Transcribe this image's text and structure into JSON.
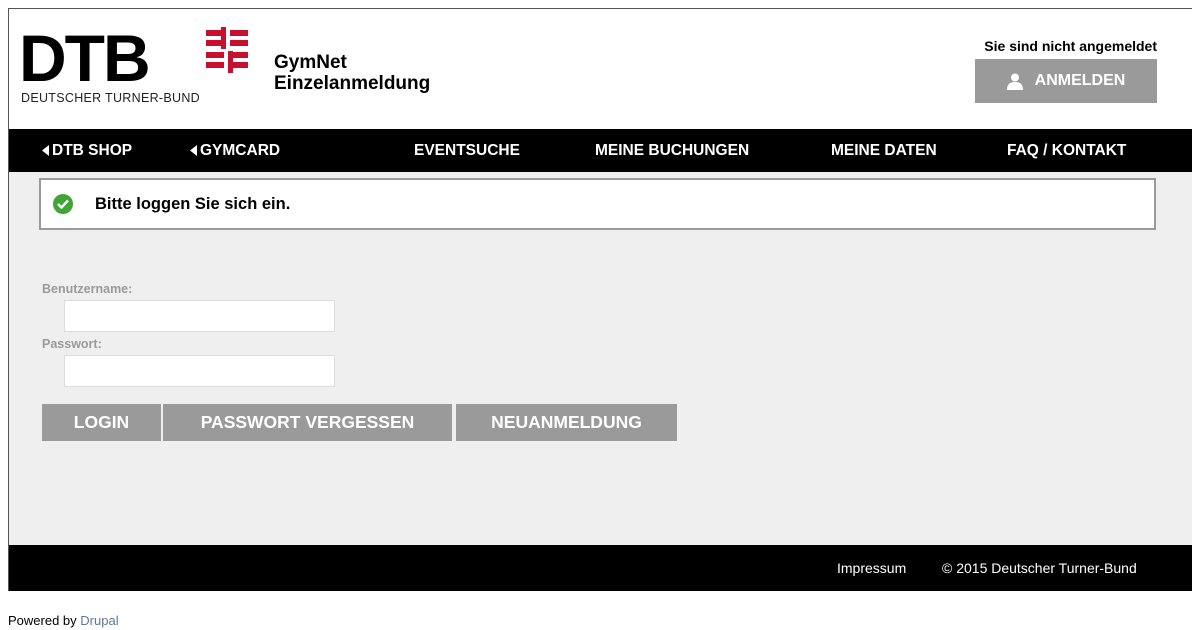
{
  "header": {
    "logo_main": "DTB",
    "logo_sub": "DEUTSCHER TURNER-BUND",
    "app_title_line1": "GymNet",
    "app_title_line2": "Einzelanmeldung",
    "login_status": "Sie sind nicht angemeldet",
    "login_button": "ANMELDEN",
    "brand_color": "#c8102e"
  },
  "nav": {
    "items": [
      {
        "label": "DTB SHOP",
        "icon": "caret-left-icon"
      },
      {
        "label": "GYMCARD",
        "icon": "caret-left-icon"
      },
      {
        "label": "EVENTSUCHE"
      },
      {
        "label": "MEINE BUCHUNGEN"
      },
      {
        "label": "MEINE DATEN"
      },
      {
        "label": "FAQ / KONTAKT"
      }
    ]
  },
  "alert": {
    "icon": "check-circle-icon",
    "text": "Bitte loggen Sie sich ein.",
    "color": "#3fa535"
  },
  "form": {
    "username_label": "Benutzername:",
    "username_value": "",
    "password_label": "Passwort:",
    "password_value": "",
    "login_button": "LOGIN",
    "forgot_button": "PASSWORT VERGESSEN",
    "register_button": "NEUANMELDUNG"
  },
  "footer": {
    "impressum": "Impressum",
    "copyright": "© 2015 Deutscher Turner-Bund"
  },
  "powered": {
    "prefix": "Powered by",
    "link": "Drupal"
  }
}
